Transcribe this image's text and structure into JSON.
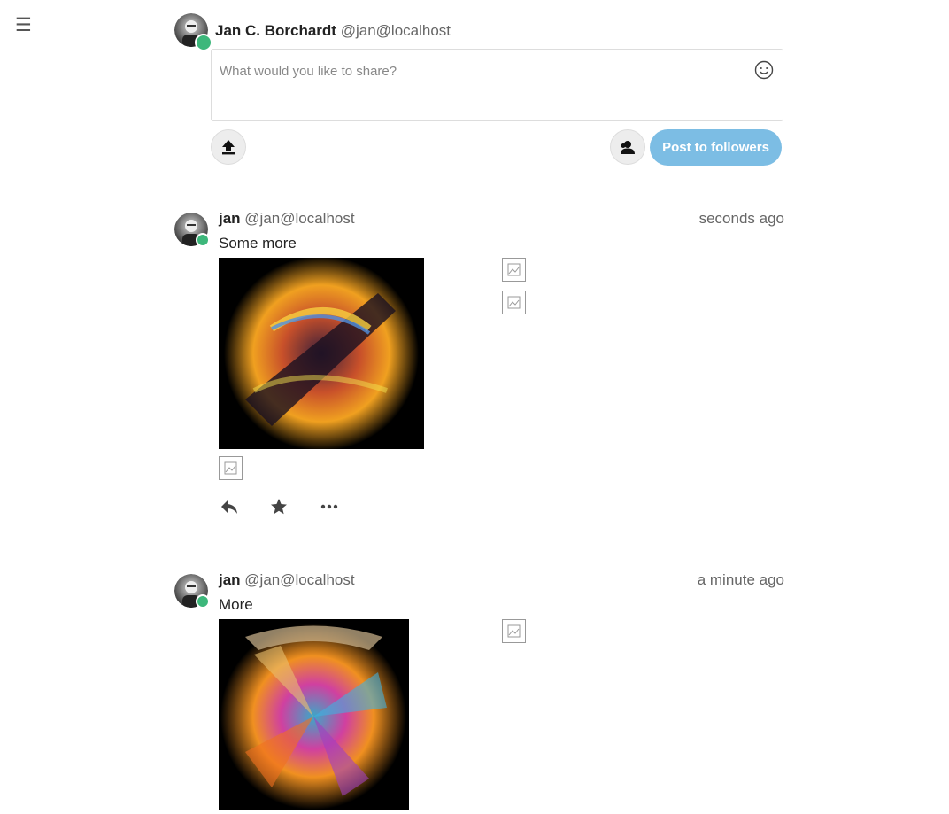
{
  "nav": {
    "menu_glyph": "☰"
  },
  "composer": {
    "author_name": "Jan C. Borchardt",
    "author_handle": "@jan@localhost",
    "placeholder": "What would you like to share?",
    "post_button": "Post to followers",
    "icons": {
      "emoji": "smiley-icon",
      "upload": "upload-icon",
      "visibility": "followers-icon"
    }
  },
  "posts": [
    {
      "author": "jan",
      "handle": "@jan@localhost",
      "time": "seconds ago",
      "text": "Some more",
      "actions": [
        "reply-icon",
        "star-icon",
        "more-icon"
      ]
    },
    {
      "author": "jan",
      "handle": "@jan@localhost",
      "time": "a minute ago",
      "text": "More"
    }
  ],
  "colors": {
    "accent": "#7cbde4",
    "status_online": "#3db77b",
    "muted_text": "#666666"
  }
}
